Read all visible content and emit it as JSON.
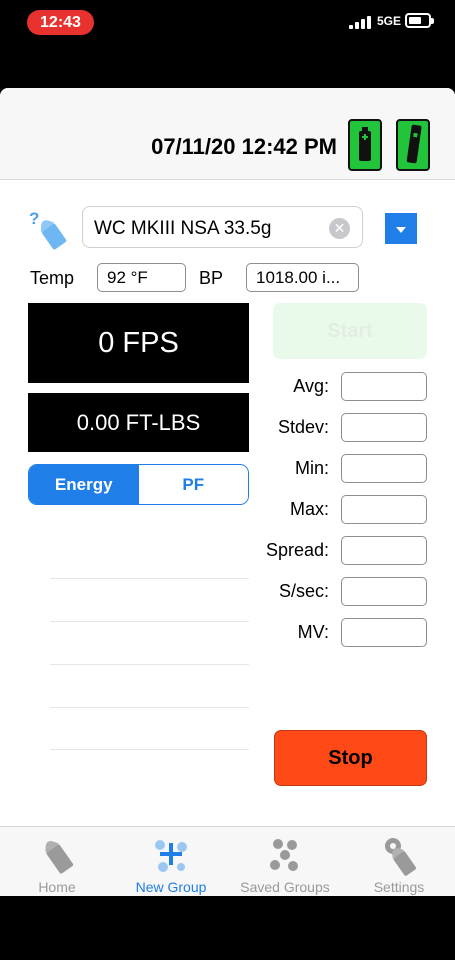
{
  "status_bar": {
    "time": "12:43",
    "network": "5GE"
  },
  "header": {
    "datetime": "07/11/20 12:42 PM"
  },
  "ammo": {
    "value": "WC MKIII NSA 33.5g",
    "clear_glyph": "✕"
  },
  "conditions": {
    "temp_label": "Temp",
    "temp_value": "92 °F",
    "bp_label": "BP",
    "bp_value": "1018.00 i..."
  },
  "displays": {
    "velocity": "0 FPS",
    "energy": "0.00 FT-LBS"
  },
  "segmented": {
    "energy_label": "Energy",
    "pf_label": "PF",
    "selected": "Energy"
  },
  "start_label": "Start",
  "stop_label": "Stop",
  "stats": [
    {
      "label": "Avg:",
      "value": ""
    },
    {
      "label": "Stdev:",
      "value": ""
    },
    {
      "label": "Min:",
      "value": ""
    },
    {
      "label": "Max:",
      "value": ""
    },
    {
      "label": "Spread:",
      "value": ""
    },
    {
      "label": "S/sec:",
      "value": ""
    },
    {
      "label": "MV:",
      "value": ""
    }
  ],
  "tabs": [
    {
      "label": "Home",
      "icon": "home-bullet-icon"
    },
    {
      "label": "New Group",
      "icon": "new-group-icon",
      "active": true
    },
    {
      "label": "Saved Groups",
      "icon": "saved-groups-icon"
    },
    {
      "label": "Settings",
      "icon": "settings-gear-icon"
    }
  ],
  "colors": {
    "accent": "#1f7ee8",
    "stop": "#ff4a18",
    "device": "#21c43a",
    "time_pill": "#e8322f"
  }
}
